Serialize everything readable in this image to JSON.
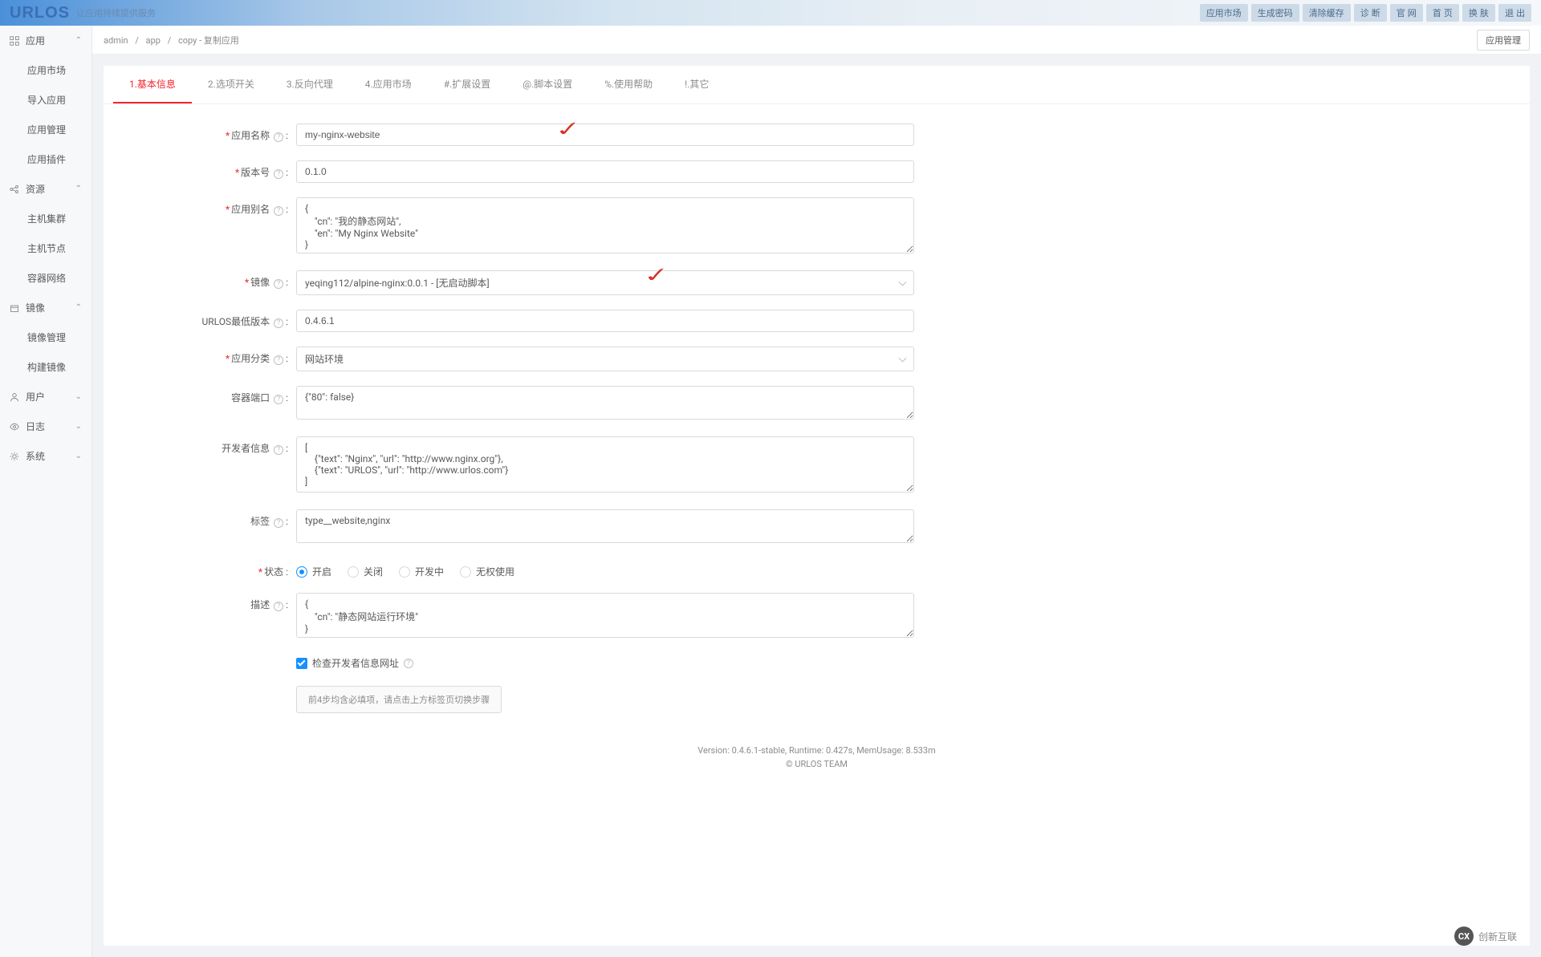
{
  "header": {
    "logo": "URLOS",
    "slogan": "让应用持续提供服务",
    "buttons": [
      "应用市场",
      "生成密码",
      "清除缓存",
      "诊 断",
      "官 网",
      "首 页",
      "换 肤",
      "退 出"
    ]
  },
  "sidebar": {
    "groups": [
      {
        "icon": "apps",
        "title": "应用",
        "expanded": true,
        "items": [
          "应用市场",
          "导入应用",
          "应用管理",
          "应用插件"
        ]
      },
      {
        "icon": "share",
        "title": "资源",
        "expanded": true,
        "items": [
          "主机集群",
          "主机节点",
          "容器网络"
        ]
      },
      {
        "icon": "box",
        "title": "镜像",
        "expanded": true,
        "items": [
          "镜像管理",
          "构建镜像"
        ]
      },
      {
        "icon": "user",
        "title": "用户",
        "expanded": false,
        "items": []
      },
      {
        "icon": "eye",
        "title": "日志",
        "expanded": false,
        "items": []
      },
      {
        "icon": "gear",
        "title": "系统",
        "expanded": false,
        "items": []
      }
    ]
  },
  "breadcrumb": {
    "parts": [
      "admin",
      "app",
      "copy"
    ],
    "current": "复制应用",
    "manage_btn": "应用管理"
  },
  "tabs": [
    "1.基本信息",
    "2.选项开关",
    "3.反向代理",
    "4.应用市场",
    "#.扩展设置",
    "@.脚本设置",
    "%.使用帮助",
    "!.其它"
  ],
  "form": {
    "app_name": {
      "label": "应用名称",
      "value": "my-nginx-website"
    },
    "version": {
      "label": "版本号",
      "value": "0.1.0"
    },
    "aliases": {
      "label": "应用别名",
      "value": "{\n    \"cn\": \"我的静态网站\",\n    \"en\": \"My Nginx Website\"\n}"
    },
    "image": {
      "label": "镜像",
      "value": "yeqing112/alpine-nginx:0.0.1 - [无启动脚本]"
    },
    "min_version": {
      "label": "URLOS最低版本",
      "value": "0.4.6.1"
    },
    "category": {
      "label": "应用分类",
      "value": "网站环境"
    },
    "ports": {
      "label": "容器端口",
      "value": "{\"80\": false}"
    },
    "developer": {
      "label": "开发者信息",
      "value": "[\n    {\"text\": \"Nginx\", \"url\": \"http://www.nginx.org\"},\n    {\"text\": \"URLOS\", \"url\": \"http://www.urlos.com\"}\n]"
    },
    "tags": {
      "label": "标签",
      "value": "type__website,nginx"
    },
    "status": {
      "label": "状态",
      "options": [
        "开启",
        "关闭",
        "开发中",
        "无权使用"
      ],
      "selected": 0
    },
    "description": {
      "label": "描述",
      "value": "{\n    \"cn\": \"静态网站运行环境\"\n}"
    },
    "checkbox": {
      "label": "检查开发者信息网址"
    },
    "hint": "前4步均含必填项，请点击上方标签页切换步骤"
  },
  "footer": {
    "line1": "Version: 0.4.6.1-stable,   Runtime: 0.427s,   MemUsage: 8.533m",
    "line2": "© URLOS TEAM"
  },
  "watermark": "创新互联"
}
